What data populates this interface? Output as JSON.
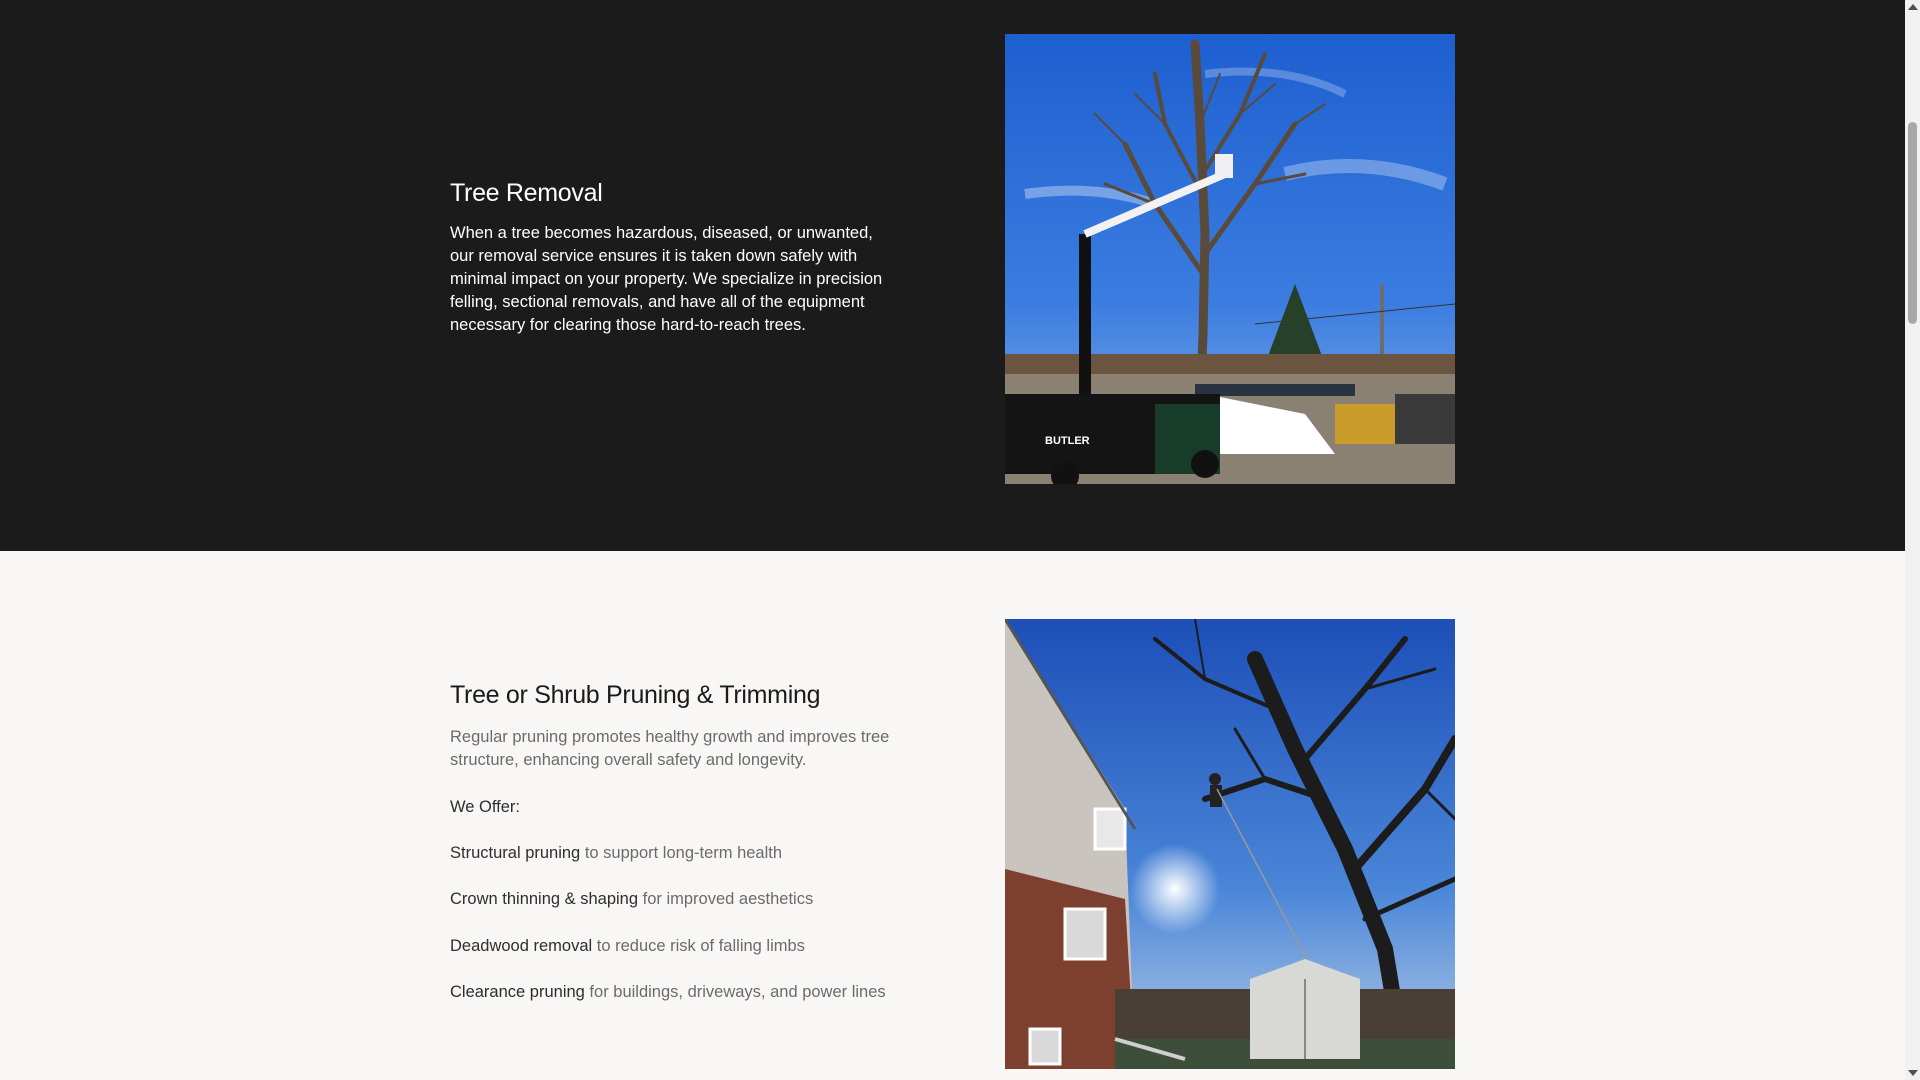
{
  "services": [
    {
      "title": "Tree Removal",
      "description": "When a tree becomes hazardous, diseased, or unwanted, our removal service ensures it is taken down safely with minimal impact on your property. We specialize in precision felling, sectional removals, and have all of the equipment necessary for clearing those hard-to-reach trees.",
      "image": {
        "truck_logo_text": "BUTLER"
      }
    },
    {
      "title": "Tree or Shrub Pruning & Trimming",
      "description": "Regular pruning promotes healthy growth and improves tree structure, enhancing overall safety and longevity.",
      "offer_heading": "We Offer:",
      "offers": [
        {
          "strong": "Structural pruning",
          "rest": " to support long-term health"
        },
        {
          "strong": "Crown thinning & shaping",
          "rest": " for improved aesthetics"
        },
        {
          "strong": "Deadwood removal",
          "rest": " to reduce risk of falling limbs"
        },
        {
          "strong": "Clearance pruning",
          "rest": " for buildings, driveways, and power lines"
        }
      ]
    }
  ],
  "colors": {
    "dark_section": "#1b1b1b",
    "light_section": "#f8f7f5",
    "sky": "#2f6fd6"
  }
}
